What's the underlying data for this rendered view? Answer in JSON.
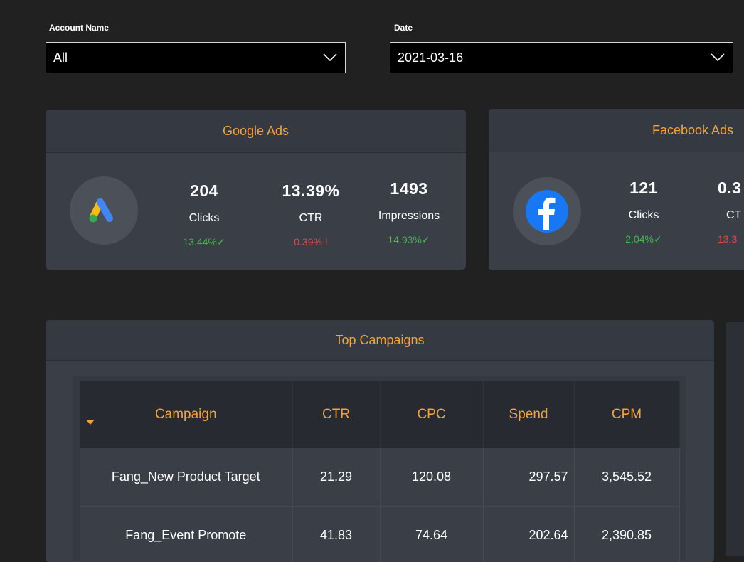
{
  "filters": {
    "account": {
      "label": "Account Name",
      "value": "All"
    },
    "date": {
      "label": "Date",
      "value": "2021-03-16"
    }
  },
  "google_ads": {
    "title": "Google Ads",
    "icon": "google-ads-icon",
    "metrics": [
      {
        "value": "204",
        "label": "Clicks",
        "change": "13.44%",
        "status": "good"
      },
      {
        "value": "13.39%",
        "label": "CTR",
        "change": "0.39%",
        "status": "bad"
      },
      {
        "value": "1493",
        "label": "Impressions",
        "change": "14.93%",
        "status": "good"
      }
    ]
  },
  "facebook_ads": {
    "title": "Facebook Ads",
    "icon": "facebook-icon",
    "metrics": [
      {
        "value": "121",
        "label": "Clicks",
        "change": "2.04%",
        "status": "good"
      },
      {
        "value": "0.3",
        "label": "CT",
        "change": "13.3",
        "status": "bad"
      }
    ]
  },
  "top_campaigns": {
    "title": "Top Campaigns",
    "columns": [
      "Campaign",
      "CTR",
      "CPC",
      "Spend",
      "CPM"
    ],
    "rows": [
      [
        "Fang_New Product Target",
        "21.29",
        "120.08",
        "297.57",
        "3,545.52"
      ],
      [
        "Fang_Event Promote",
        "41.83",
        "74.64",
        "202.64",
        "2,390.85"
      ]
    ]
  },
  "colors": {
    "background": "#212121",
    "card": "#3a3f47",
    "accent": "#f5a23a",
    "good": "#43b54c",
    "bad": "#e04848"
  }
}
